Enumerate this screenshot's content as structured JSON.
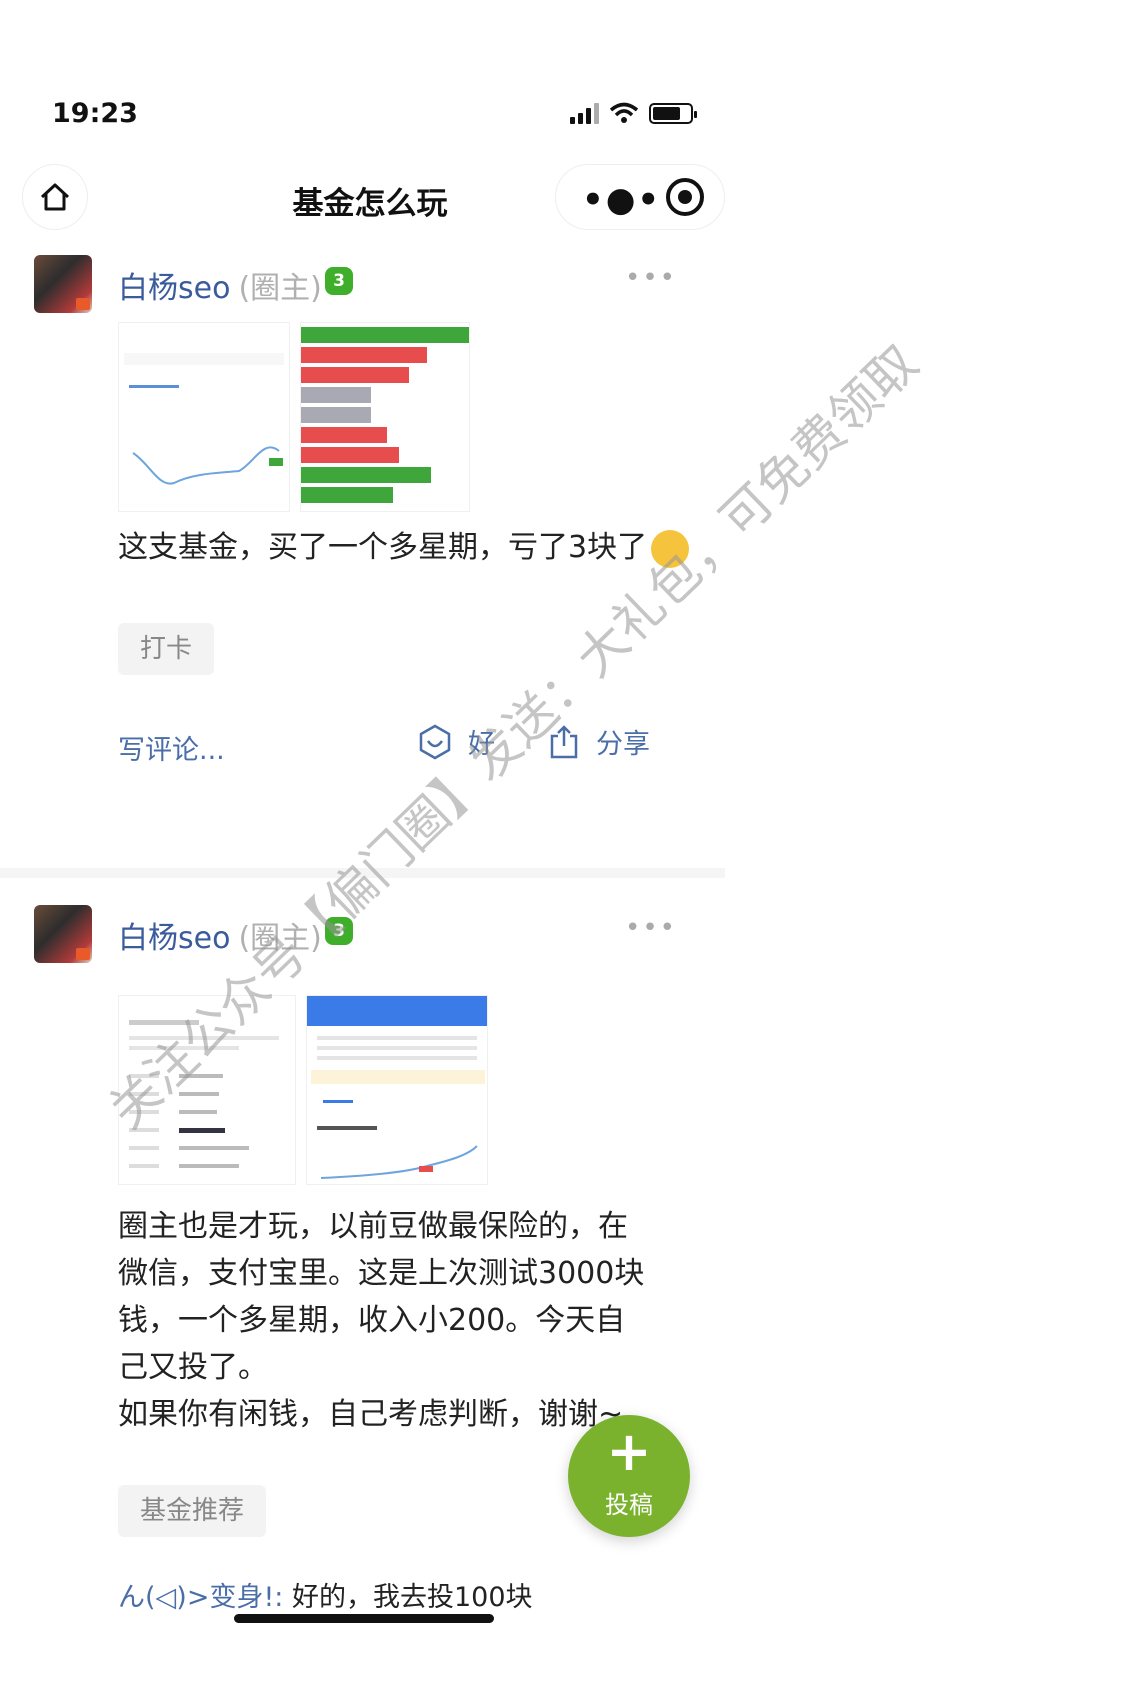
{
  "status_bar": {
    "time": "19:23"
  },
  "nav": {
    "title": "基金怎么玩"
  },
  "posts": [
    {
      "author": "白杨seo",
      "role": "(圈主)",
      "level": "3",
      "text": "这支基金，买了一个多星期，亏了3块了",
      "tag": "打卡",
      "comment_placeholder": "写评论...",
      "like_label": "好",
      "share_label": "分享"
    },
    {
      "author": "白杨seo",
      "role": "(圈主)",
      "level": "3",
      "text_lines": [
        "圈主也是才玩，以前豆做最保险的，在",
        "微信，支付宝里。这是上次测试3000块",
        "钱，一个多星期，收入小200。今天自",
        "己又投了。",
        "如果你有闲钱，自己考虑判断，谢谢~"
      ],
      "tag": "基金推荐",
      "comment": {
        "author": "ん(◁)>变身!:",
        "text": "好的，我去投100块"
      }
    }
  ],
  "fab": {
    "label": "投稿"
  },
  "watermark": "关注公众号【偏门圈】发送：大礼包，可免费领取",
  "colors": {
    "link": "#4a6ea8",
    "badge": "#3fae2a",
    "fab": "#7ab22e",
    "red_bar": "#e84d4d",
    "green_bar": "#3ea63a"
  },
  "icons": [
    "home-icon",
    "more-icon",
    "close-target-icon",
    "post-more-icon",
    "like-icon",
    "share-icon",
    "plus-icon"
  ]
}
